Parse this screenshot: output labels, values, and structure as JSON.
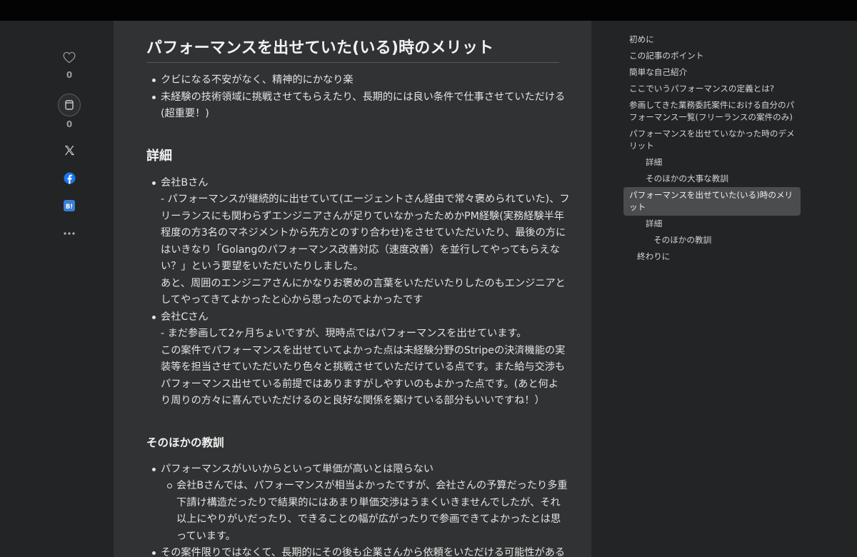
{
  "share": {
    "like_count": "0",
    "save_count": "0"
  },
  "article": {
    "section_title": "パフォーマンスを出せていた(いる)時のメリット",
    "merits": [
      [
        "クビになる不安がなく、精神的にかなり楽"
      ],
      [
        "未経験の技術領域に挑戦させてもらえたり、長期的には良い条件で仕事させていただける",
        "(超重要！)"
      ]
    ],
    "detail_heading": "詳細",
    "companies": [
      {
        "name": "会社Bさん",
        "lines": [
          "- パフォーマンスが継続的に出せていて(エージェントさん経由で常々褒められていた)、フ",
          "リーランスにも関わらずエンジニアさんが足りていなかったためかPM経験(実務経験半年",
          "程度の方3名のマネジメントから先方とのすり合わせ)をさせていただいたり、最後の方に",
          "はいきなり「Golangのパフォーマンス改善対応（速度改善）を並行してやってもらえな",
          "い？」という要望をいただいたりしました。",
          "あと、周囲のエンジニアさんにかなりお褒めの言葉をいただいたりしたのもエンジニアと",
          "してやってきてよかったと心から思ったのでよかったです"
        ]
      },
      {
        "name": "会社Cさん",
        "lines": [
          "- まだ参画して2ヶ月ちょいですが、現時点ではパフォーマンスを出せています。",
          "この案件でパフォーマンスを出せていてよかった点は未経験分野のStripeの決済機能の実",
          "装等を担当させていただいたり色々と挑戦させていただけている点です。また給与交渉も",
          "パフォーマンス出せている前提ではありますがしやすいのもよかった点です。(あと何よ",
          "り周りの方々に喜んでいただけるのと良好な関係を築けている部分もいいですね！）"
        ]
      }
    ],
    "other_heading": "そのほかの教訓",
    "lessons": [
      {
        "text": "パフォーマンスがいいからといって単価が高いとは限らない",
        "sub_lines": [
          "会社Bさんでは、パフォーマンスが相当よかったですが、会社さんの予算だったり多重",
          "下請け構造だったりで結果的にはあまり単価交渉はうまくいきませんでしたが、それ",
          "以上にやりがいだったり、できることの幅が広がったりで参画できてよかったとは思",
          "っています。"
        ]
      },
      {
        "text": "その案件限りではなくて、長期的にその後も企業さんから依頼をいただける可能性がある",
        "sub_lines": []
      }
    ]
  },
  "toc": [
    {
      "label": "初めに",
      "level": 1,
      "active": false
    },
    {
      "label": "この記事のポイント",
      "level": 1,
      "active": false
    },
    {
      "label": "簡単な自己紹介",
      "level": 1,
      "active": false
    },
    {
      "label": "ここでいうパフォーマンスの定義とは?",
      "level": 1,
      "active": false
    },
    {
      "label": "参画してきた業務委託案件における自分のパフォーマンス一覧(フリーランスの案件のみ)",
      "level": 1,
      "active": false
    },
    {
      "label": "パフォーマンスを出せていなかった時のデメリット",
      "level": 1,
      "active": false
    },
    {
      "label": "詳細",
      "level": 2,
      "active": false
    },
    {
      "label": "そのほかの大事な教訓",
      "level": 2,
      "active": false
    },
    {
      "label": "パフォーマンスを出せていた(いる)時のメリット",
      "level": 1,
      "active": true
    },
    {
      "label": "詳細",
      "level": 2,
      "active": false
    },
    {
      "label": "そのほかの教訓",
      "level": 3,
      "active": false
    },
    {
      "label": "終わりに",
      "level": 4,
      "active": false
    }
  ],
  "icons": {
    "like": "heart-icon",
    "save": "bookmark-icon",
    "x": "x-logo-icon",
    "facebook": "facebook-icon",
    "hatena": "hatena-bookmark-icon",
    "more": "more-icon"
  },
  "colors": {
    "background": "#222425",
    "article_bg": "#303233",
    "facebook": "#1877f2",
    "hatena": "#3b7ed6",
    "toc_active": "#4a4c4e"
  }
}
